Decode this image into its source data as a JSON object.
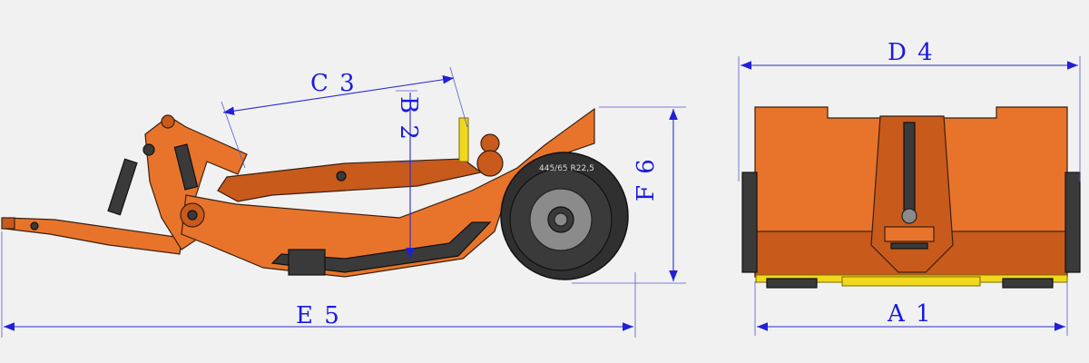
{
  "dimensions": {
    "a": "A 1",
    "b": "B 2",
    "c": "C 3",
    "d": "D 4",
    "e": "E 5",
    "f": "F 6"
  },
  "tyre_label": "445/65 R22,5",
  "colors": {
    "body": "#e8742c",
    "body_dark": "#c85a1c",
    "dimension": "#1a1adf",
    "skid": "#f0d81e",
    "background": "#f1f1f1"
  }
}
